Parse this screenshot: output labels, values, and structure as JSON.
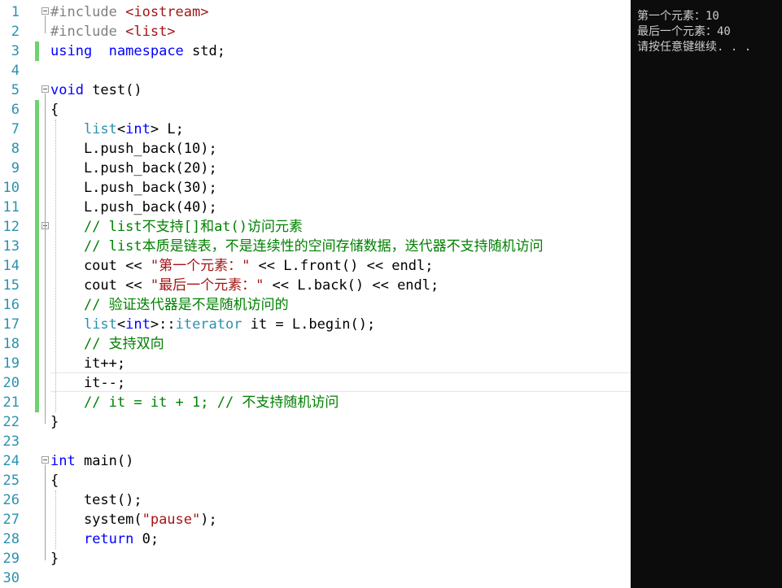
{
  "editor": {
    "lines": [
      {
        "n": "1",
        "tokens": [
          [
            "pp",
            "#include "
          ],
          [
            "inc",
            "<iostream>"
          ]
        ]
      },
      {
        "n": "2",
        "tokens": [
          [
            "pp",
            "#include "
          ],
          [
            "inc",
            "<list>"
          ]
        ]
      },
      {
        "n": "3",
        "tokens": [
          [
            "kw",
            "using"
          ],
          [
            "",
            "  "
          ],
          [
            "kw",
            "namespace"
          ],
          [
            "",
            " std;"
          ]
        ]
      },
      {
        "n": "4",
        "tokens": []
      },
      {
        "n": "5",
        "tokens": [
          [
            "kw",
            "void"
          ],
          [
            "",
            " test()"
          ]
        ]
      },
      {
        "n": "6",
        "tokens": [
          [
            "",
            "{"
          ]
        ]
      },
      {
        "n": "7",
        "tokens": [
          [
            "",
            "    "
          ],
          [
            "ty",
            "list"
          ],
          [
            "",
            "<"
          ],
          [
            "kw",
            "int"
          ],
          [
            "",
            "> L;"
          ]
        ]
      },
      {
        "n": "8",
        "tokens": [
          [
            "",
            "    L.push_back(10);"
          ]
        ]
      },
      {
        "n": "9",
        "tokens": [
          [
            "",
            "    L.push_back(20);"
          ]
        ]
      },
      {
        "n": "10",
        "tokens": [
          [
            "",
            "    L.push_back(30);"
          ]
        ]
      },
      {
        "n": "11",
        "tokens": [
          [
            "",
            "    L.push_back(40);"
          ]
        ]
      },
      {
        "n": "12",
        "tokens": [
          [
            "",
            "    "
          ],
          [
            "cm",
            "// list不支持[]和at()访问元素"
          ]
        ]
      },
      {
        "n": "13",
        "tokens": [
          [
            "",
            "    "
          ],
          [
            "cm",
            "// list本质是链表，不是连续性的空间存储数据，迭代器不支持随机访问"
          ]
        ]
      },
      {
        "n": "14",
        "tokens": [
          [
            "",
            "    cout << "
          ],
          [
            "str",
            "\"第一个元素：\""
          ],
          [
            "",
            " << L.front() << endl;"
          ]
        ]
      },
      {
        "n": "15",
        "tokens": [
          [
            "",
            "    cout << "
          ],
          [
            "str",
            "\"最后一个元素：\""
          ],
          [
            "",
            " << L.back() << endl;"
          ]
        ]
      },
      {
        "n": "16",
        "tokens": [
          [
            "",
            "    "
          ],
          [
            "cm",
            "// 验证迭代器是不是随机访问的"
          ]
        ]
      },
      {
        "n": "17",
        "tokens": [
          [
            "",
            "    "
          ],
          [
            "ty",
            "list"
          ],
          [
            "",
            "<"
          ],
          [
            "kw",
            "int"
          ],
          [
            "",
            ">::"
          ],
          [
            "ty",
            "iterator"
          ],
          [
            "",
            " it = L.begin();"
          ]
        ]
      },
      {
        "n": "18",
        "tokens": [
          [
            "",
            "    "
          ],
          [
            "cm",
            "// 支持双向"
          ]
        ]
      },
      {
        "n": "19",
        "tokens": [
          [
            "",
            "    it++;"
          ]
        ]
      },
      {
        "n": "20",
        "tokens": [
          [
            "",
            "    it--;"
          ]
        ]
      },
      {
        "n": "21",
        "tokens": [
          [
            "",
            "    "
          ],
          [
            "cm",
            "// it = it + 1; // 不支持随机访问"
          ]
        ]
      },
      {
        "n": "22",
        "tokens": [
          [
            "",
            "}"
          ]
        ]
      },
      {
        "n": "23",
        "tokens": []
      },
      {
        "n": "24",
        "tokens": [
          [
            "kw",
            "int"
          ],
          [
            "",
            " main()"
          ]
        ]
      },
      {
        "n": "25",
        "tokens": [
          [
            "",
            "{"
          ]
        ]
      },
      {
        "n": "26",
        "tokens": [
          [
            "",
            "    test();"
          ]
        ]
      },
      {
        "n": "27",
        "tokens": [
          [
            "",
            "    system("
          ],
          [
            "str",
            "\"pause\""
          ],
          [
            "",
            ");"
          ]
        ]
      },
      {
        "n": "28",
        "tokens": [
          [
            "",
            "    "
          ],
          [
            "kw",
            "return"
          ],
          [
            "",
            " 0;"
          ]
        ]
      },
      {
        "n": "29",
        "tokens": [
          [
            "",
            "}"
          ]
        ]
      },
      {
        "n": "30",
        "tokens": []
      }
    ]
  },
  "console": {
    "lines": [
      "第一个元素：10",
      "最后一个元素：40",
      "请按任意键继续. . ."
    ]
  },
  "colors": {
    "keyword": "#0000ff",
    "type": "#2b91af",
    "string": "#a31515",
    "comment": "#008000",
    "preprocessor": "#808080",
    "line_number": "#2b91af",
    "change_bar": "#6ed36e",
    "console_bg": "#0c0c0c",
    "console_fg": "#cccccc"
  }
}
